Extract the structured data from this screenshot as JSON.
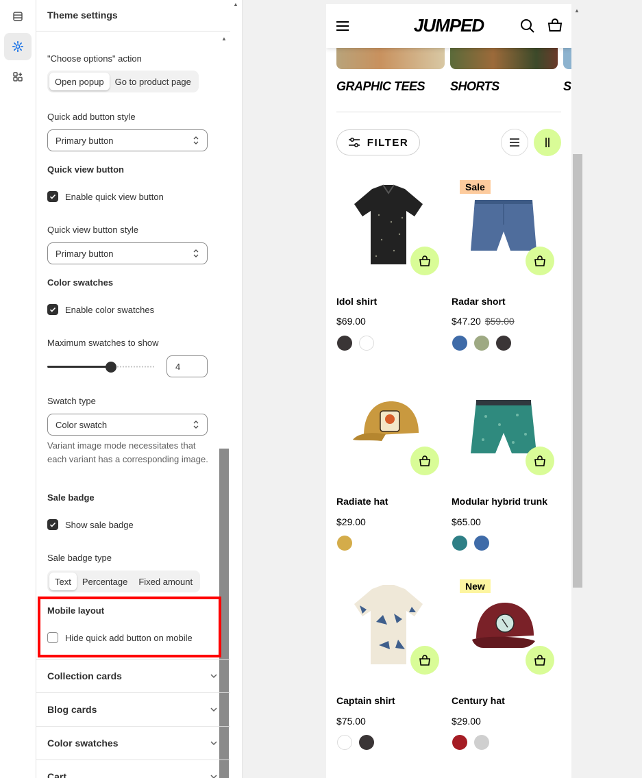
{
  "rail": {
    "icons": [
      "sections-icon",
      "settings-gear-icon",
      "apps-icon"
    ]
  },
  "panel": {
    "title": "Theme settings",
    "choose_options": {
      "label": "\"Choose options\" action",
      "options": [
        "Open popup",
        "Go to product page"
      ],
      "selected": "Open popup"
    },
    "quick_add_style": {
      "label": "Quick add button style",
      "value": "Primary button"
    },
    "quick_view": {
      "heading": "Quick view button",
      "checkbox": "Enable quick view button",
      "checked": true
    },
    "quick_view_style": {
      "label": "Quick view button style",
      "value": "Primary button"
    },
    "color_swatches": {
      "heading": "Color swatches",
      "checkbox": "Enable color swatches",
      "checked": true
    },
    "max_swatches": {
      "label": "Maximum swatches to show",
      "value": "4"
    },
    "swatch_type": {
      "label": "Swatch type",
      "value": "Color swatch",
      "help": "Variant image mode necessitates that each variant has a corresponding image."
    },
    "sale_badge": {
      "heading": "Sale badge",
      "checkbox": "Show sale badge",
      "checked": true
    },
    "sale_badge_type": {
      "label": "Sale badge type",
      "options": [
        "Text",
        "Percentage",
        "Fixed amount"
      ],
      "selected": "Text"
    },
    "mobile_layout": {
      "heading": "Mobile layout",
      "checkbox": "Hide quick add button on mobile",
      "checked": false
    },
    "accordions": [
      "Collection cards",
      "Blog cards",
      "Color swatches",
      "Cart"
    ]
  },
  "store": {
    "logo": "JUMPED",
    "categories": [
      "GRAPHIC TEES",
      "SHORTS",
      "S"
    ],
    "filter_label": "FILTER",
    "products": [
      {
        "name": "Idol shirt",
        "price": "$69.00",
        "old_price": "",
        "badge": "",
        "swatches": [
          "#3a3536",
          "#ffffff"
        ]
      },
      {
        "name": "Radar short",
        "price": "$47.20",
        "old_price": "$59.00",
        "badge": "Sale",
        "swatches": [
          "#3f6ba8",
          "#9ea983",
          "#3a3536"
        ]
      },
      {
        "name": "Radiate hat",
        "price": "$29.00",
        "old_price": "",
        "badge": "",
        "swatches": [
          "#d4ac4a"
        ]
      },
      {
        "name": "Modular hybrid trunk",
        "price": "$65.00",
        "old_price": "",
        "badge": "",
        "swatches": [
          "#2e7f86",
          "#3f6ba8"
        ]
      },
      {
        "name": "Captain shirt",
        "price": "$75.00",
        "old_price": "",
        "badge": "",
        "swatches": [
          "#ffffff",
          "#3a3536"
        ]
      },
      {
        "name": "Century hat",
        "price": "$29.00",
        "old_price": "",
        "badge": "New",
        "swatches": [
          "#a51c24",
          "#cfcfcf"
        ]
      }
    ],
    "colors": {
      "accent": "#d9fc97",
      "sale_badge": "#fdcb9d",
      "new_badge": "#fdf5a0",
      "highlight": "#ff0000"
    }
  }
}
